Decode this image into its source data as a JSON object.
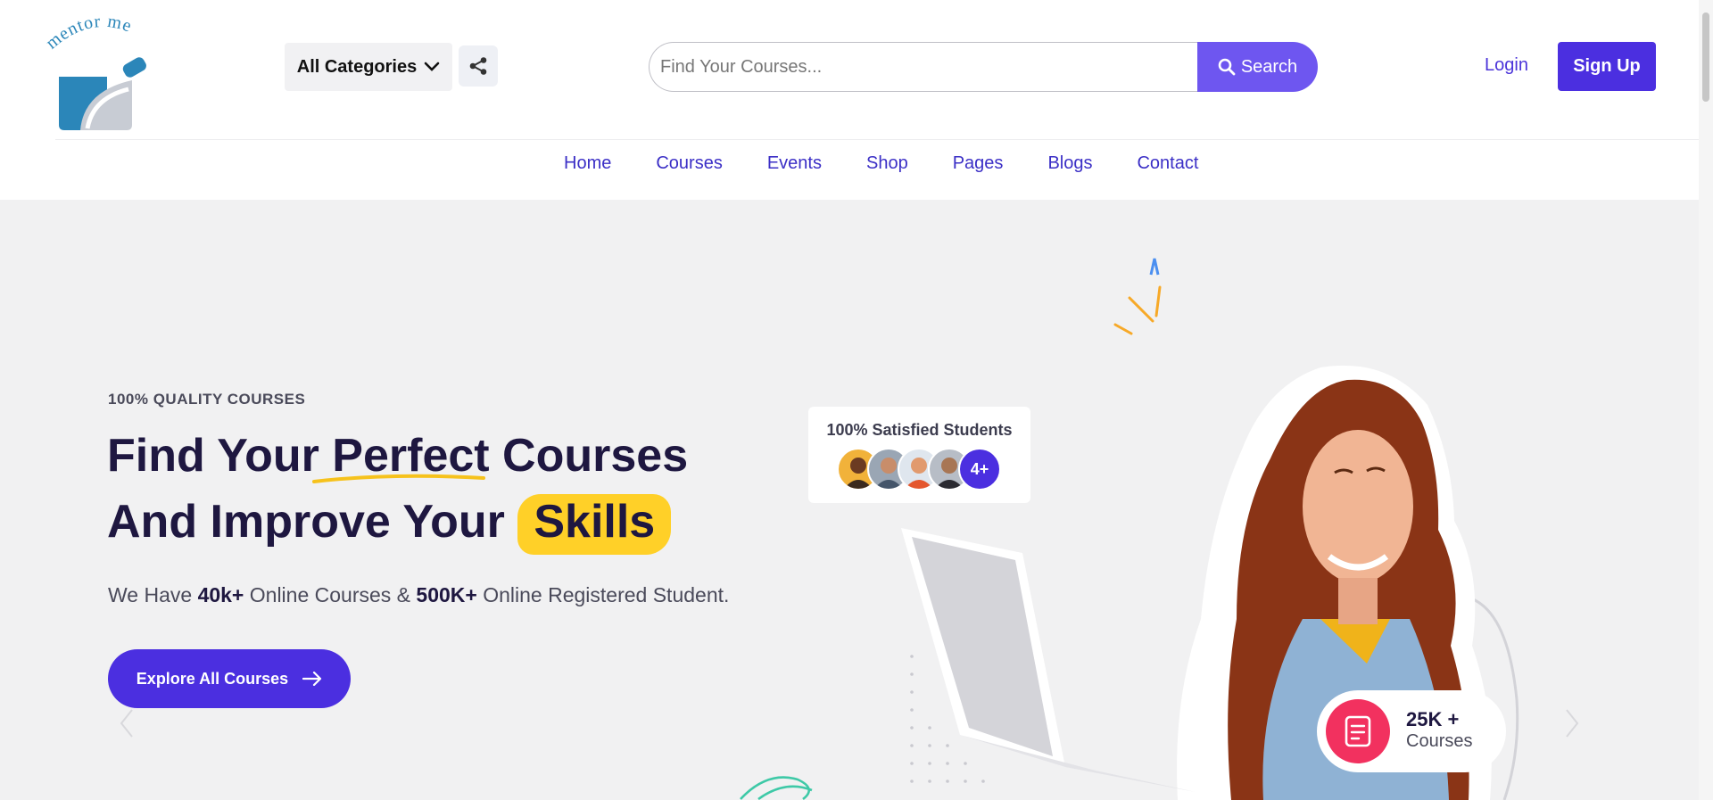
{
  "brand": {
    "logo_text": "mentor me"
  },
  "header": {
    "categories_label": "All Categories",
    "search_placeholder": "Find Your Courses...",
    "search_label": "Search",
    "login_label": "Login",
    "signup_label": "Sign Up"
  },
  "nav": {
    "items": [
      {
        "label": "Home"
      },
      {
        "label": "Courses"
      },
      {
        "label": "Events"
      },
      {
        "label": "Shop"
      },
      {
        "label": "Pages"
      },
      {
        "label": "Blogs"
      },
      {
        "label": "Contact"
      }
    ]
  },
  "hero": {
    "eyebrow": "100% QUALITY COURSES",
    "title_part1": "Find Your ",
    "title_highlight1": "Perfect",
    "title_part2": " Courses",
    "title_part3": "And Improve Your ",
    "title_highlight2": "Skills",
    "sub_prefix": "We Have ",
    "sub_num1": "40k+",
    "sub_mid": " Online Courses & ",
    "sub_num2": "500K+",
    "sub_suffix": " Online Registered Student.",
    "cta_label": "Explore All Courses",
    "satisfied_label": "100% Satisfied Students",
    "avatars_more": "4+",
    "courses_count": "25K +",
    "courses_label": "Courses"
  },
  "colors": {
    "primary": "#4b2fe0",
    "search_button": "#6e56f0",
    "highlight_yellow": "#ffd028",
    "hero_background": "#f1f1f2",
    "badge_pink": "#f2315f"
  },
  "icons": {
    "categories": "chevron-down-icon",
    "share": "share-icon",
    "search": "search-icon",
    "cta": "arrow-right-icon",
    "courses": "book-icon",
    "slider_prev": "chevron-left-icon",
    "slider_next": "chevron-right-icon"
  }
}
